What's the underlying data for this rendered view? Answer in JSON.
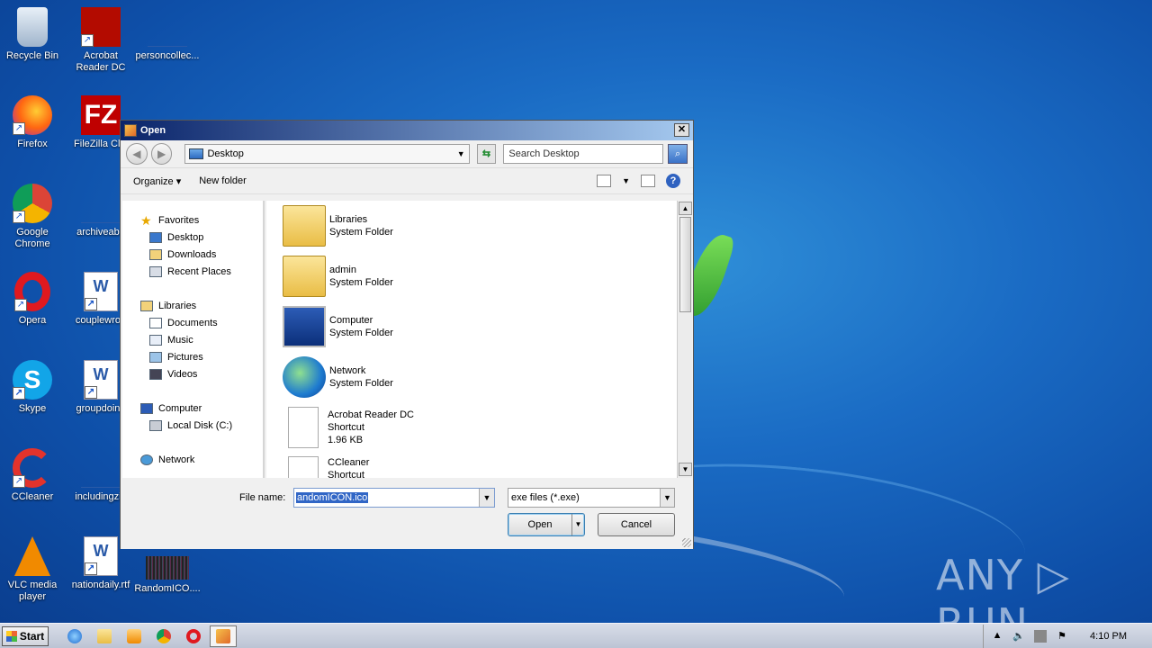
{
  "desktop": {
    "icons": [
      {
        "label": "Recycle Bin",
        "icon": "recycle-bin-icon"
      },
      {
        "label": "Acrobat Reader DC",
        "icon": "acrobat-icon"
      },
      {
        "label": "personcollec...",
        "icon": "file-icon"
      },
      {
        "label": "Firefox",
        "icon": "firefox-icon"
      },
      {
        "label": "FileZilla Clie",
        "icon": "filezilla-icon"
      },
      {
        "label": "Google Chrome",
        "icon": "chrome-icon"
      },
      {
        "label": "archiveabo",
        "icon": "file-icon"
      },
      {
        "label": "Opera",
        "icon": "opera-icon"
      },
      {
        "label": "couplewron",
        "icon": "word-doc-icon"
      },
      {
        "label": "Skype",
        "icon": "skype-icon"
      },
      {
        "label": "groupdoing",
        "icon": "word-doc-icon"
      },
      {
        "label": "CCleaner",
        "icon": "ccleaner-icon"
      },
      {
        "label": "includingzip",
        "icon": "file-icon"
      },
      {
        "label": "VLC media player",
        "icon": "vlc-icon"
      },
      {
        "label": "nationdaily.rtf",
        "icon": "word-doc-icon"
      },
      {
        "label": "RandomICO....",
        "icon": "image-icon"
      }
    ],
    "watermark": "ANY ▷ RUN"
  },
  "dialog": {
    "title": "Open",
    "close_label": "✕",
    "address": "Desktop",
    "search_placeholder": "Search Desktop",
    "toolbar": {
      "organize": "Organize",
      "new_folder": "New folder"
    },
    "nav": {
      "favorites": "Favorites",
      "desktop": "Desktop",
      "downloads": "Downloads",
      "recent_places": "Recent Places",
      "libraries": "Libraries",
      "documents": "Documents",
      "music": "Music",
      "pictures": "Pictures",
      "videos": "Videos",
      "computer": "Computer",
      "local_disk": "Local Disk (C:)",
      "network": "Network"
    },
    "files": [
      {
        "name": "Libraries",
        "type": "System Folder",
        "size": ""
      },
      {
        "name": "admin",
        "type": "System Folder",
        "size": ""
      },
      {
        "name": "Computer",
        "type": "System Folder",
        "size": ""
      },
      {
        "name": "Network",
        "type": "System Folder",
        "size": ""
      },
      {
        "name": "Acrobat Reader DC",
        "type": "Shortcut",
        "size": "1.96 KB"
      },
      {
        "name": "CCleaner",
        "type": "Shortcut",
        "size": ""
      }
    ],
    "file_name_label": "File name:",
    "file_name_value": "andomICON.ico",
    "filter_value": "exe files (*.exe)",
    "open_label": "Open",
    "cancel_label": "Cancel"
  },
  "taskbar": {
    "start_label": "Start",
    "clock": "4:10 PM"
  },
  "colors": {
    "accent": "#0a246a",
    "selection": "#3166c6"
  }
}
